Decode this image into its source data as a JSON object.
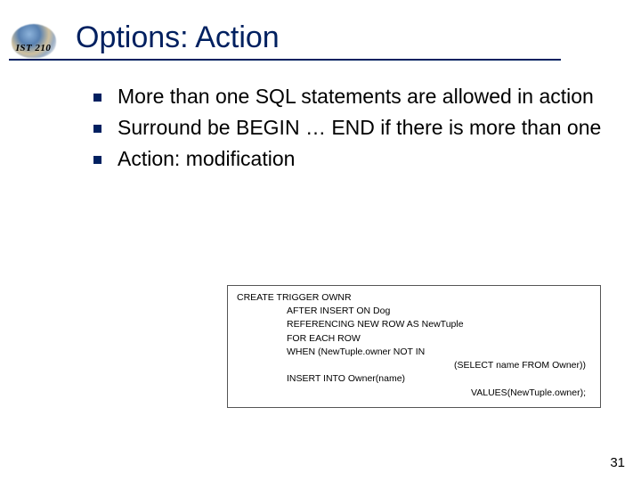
{
  "course": "IST 210",
  "title": "Options: Action",
  "bullets": [
    "More than one SQL statements are allowed in action",
    "Surround be BEGIN … END if there is more than one",
    "Action: modification"
  ],
  "code": {
    "l1": "CREATE TRIGGER OWNR",
    "l2": "AFTER INSERT ON Dog",
    "l3": "REFERENCING NEW ROW AS NewTuple",
    "l4": "FOR EACH ROW",
    "l5": "WHEN (NewTuple.owner NOT IN",
    "l6": "(SELECT name FROM Owner))",
    "l7": "INSERT INTO Owner(name)",
    "l8": "VALUES(NewTuple.owner);"
  },
  "slide_number": "31"
}
